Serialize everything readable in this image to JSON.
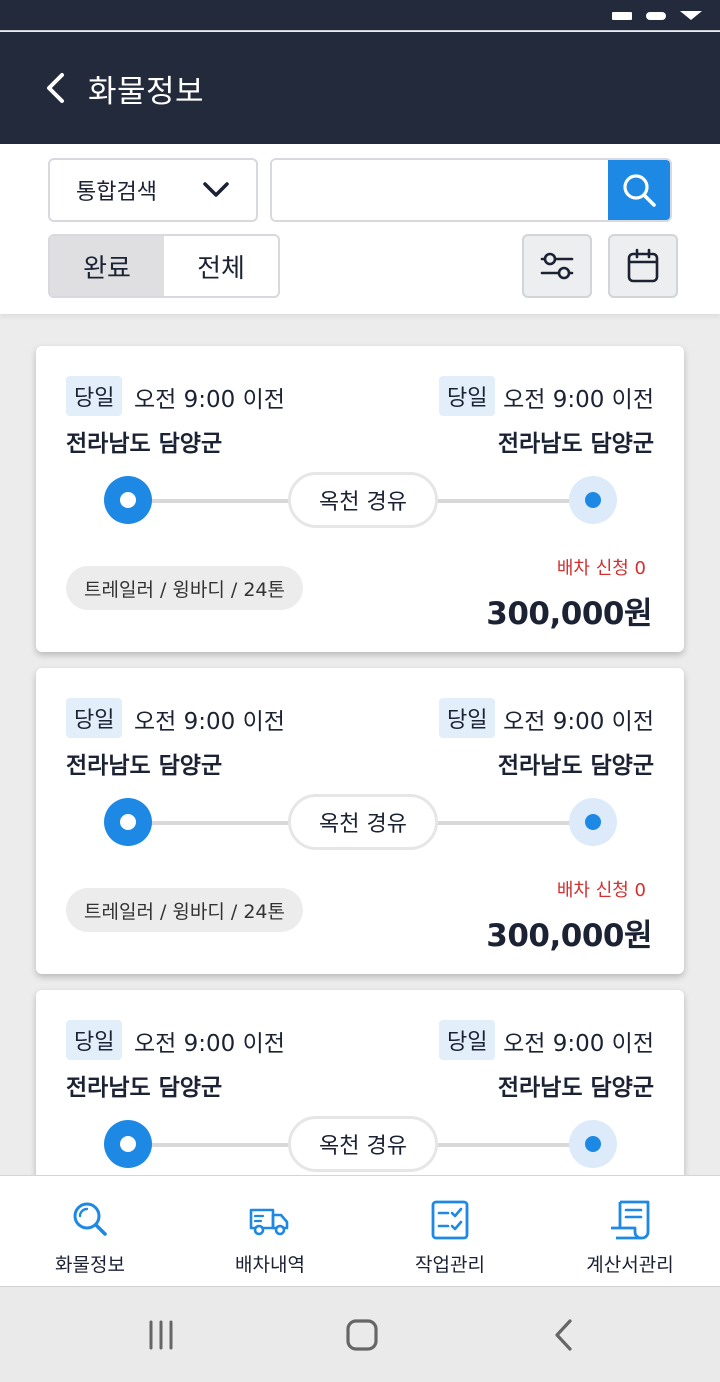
{
  "header": {
    "title": "화물정보"
  },
  "search": {
    "category_selected": "통합검색",
    "query_value": "",
    "query_placeholder": ""
  },
  "filters": {
    "tabs": [
      {
        "label": "완료",
        "active": true
      },
      {
        "label": "전체",
        "active": false
      }
    ]
  },
  "colors": {
    "accent": "#1e88e5",
    "header_bg": "#232a3b",
    "apply_text": "#d32f2f"
  },
  "cards": [
    {
      "origin": {
        "tag": "당일",
        "time": "오전 9:00 이전",
        "region": "전라남도 담양군"
      },
      "destination": {
        "tag": "당일",
        "time": "오전 9:00 이전",
        "region": "전라남도 담양군"
      },
      "via": "옥천 경유",
      "vehicle": "트레일러 / 윙바디 / 24톤",
      "apply": "배차 신청 0",
      "price": "300,000원"
    },
    {
      "origin": {
        "tag": "당일",
        "time": "오전 9:00 이전",
        "region": "전라남도 담양군"
      },
      "destination": {
        "tag": "당일",
        "time": "오전 9:00 이전",
        "region": "전라남도 담양군"
      },
      "via": "옥천 경유",
      "vehicle": "트레일러 / 윙바디 / 24톤",
      "apply": "배차 신청 0",
      "price": "300,000원"
    },
    {
      "origin": {
        "tag": "당일",
        "time": "오전 9:00 이전",
        "region": "전라남도 담양군"
      },
      "destination": {
        "tag": "당일",
        "time": "오전 9:00 이전",
        "region": "전라남도 담양군"
      },
      "via": "옥천 경유"
    }
  ],
  "bottom_nav": [
    {
      "label": "화물정보",
      "icon": "search-icon"
    },
    {
      "label": "배차내역",
      "icon": "truck-icon"
    },
    {
      "label": "작업관리",
      "icon": "checklist-icon"
    },
    {
      "label": "계산서관리",
      "icon": "receipt-icon"
    }
  ],
  "system_nav": [
    "recent-apps-icon",
    "home-icon",
    "back-icon"
  ]
}
